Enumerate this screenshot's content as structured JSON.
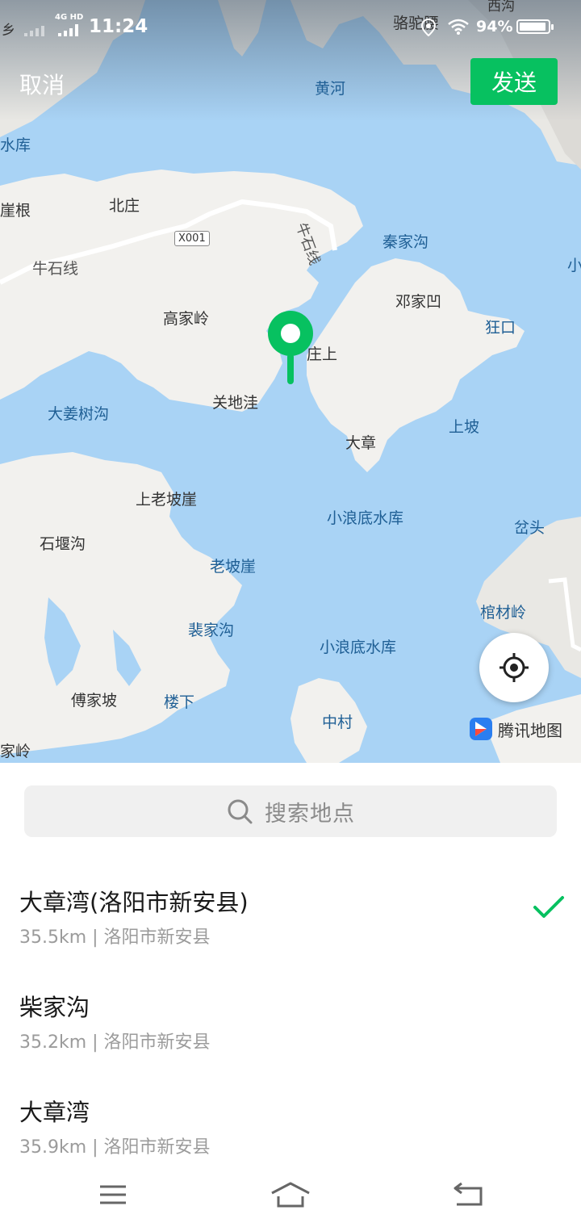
{
  "status": {
    "network": "4G HD",
    "time": "11:24",
    "battery_percent_text": "94%",
    "battery_level": 0.94
  },
  "header": {
    "cancel_label": "取消",
    "send_label": "发送",
    "send_color": "#07c160"
  },
  "map": {
    "water_labels": [
      "黄河",
      "水库",
      "秦家沟",
      "狂口",
      "大姜树沟",
      "上坡",
      "小浪底水库",
      "岔头",
      "老坡崖",
      "棺材岭",
      "裴家沟",
      "小浪底水库",
      "楼下",
      "中村"
    ],
    "land_labels": [
      "乡",
      "骆驼腰",
      "西沟",
      "北庄",
      "崖根",
      "牛石线",
      "X001",
      "牛石线",
      "高家岭",
      "邓家凹",
      "庄上",
      "关地洼",
      "大章",
      "上老坡崖",
      "石堰沟",
      "傅家坡",
      "家岭",
      "小"
    ],
    "provider": "腾讯地图",
    "pin_color": "#07c160",
    "water_color": "#a9d3f5",
    "land_color": "#f2f1ee"
  },
  "search": {
    "placeholder": "搜索地点"
  },
  "results": [
    {
      "name": "大章湾(洛阳市新安县)",
      "detail": "35.5km | 洛阳市新安县",
      "selected": true
    },
    {
      "name": "柴家沟",
      "detail": "35.2km | 洛阳市新安县",
      "selected": false
    },
    {
      "name": "大章湾",
      "detail": "35.9km | 洛阳市新安县",
      "selected": false
    }
  ],
  "navbar": {
    "icons": [
      "menu-icon",
      "home-icon",
      "back-icon"
    ]
  }
}
